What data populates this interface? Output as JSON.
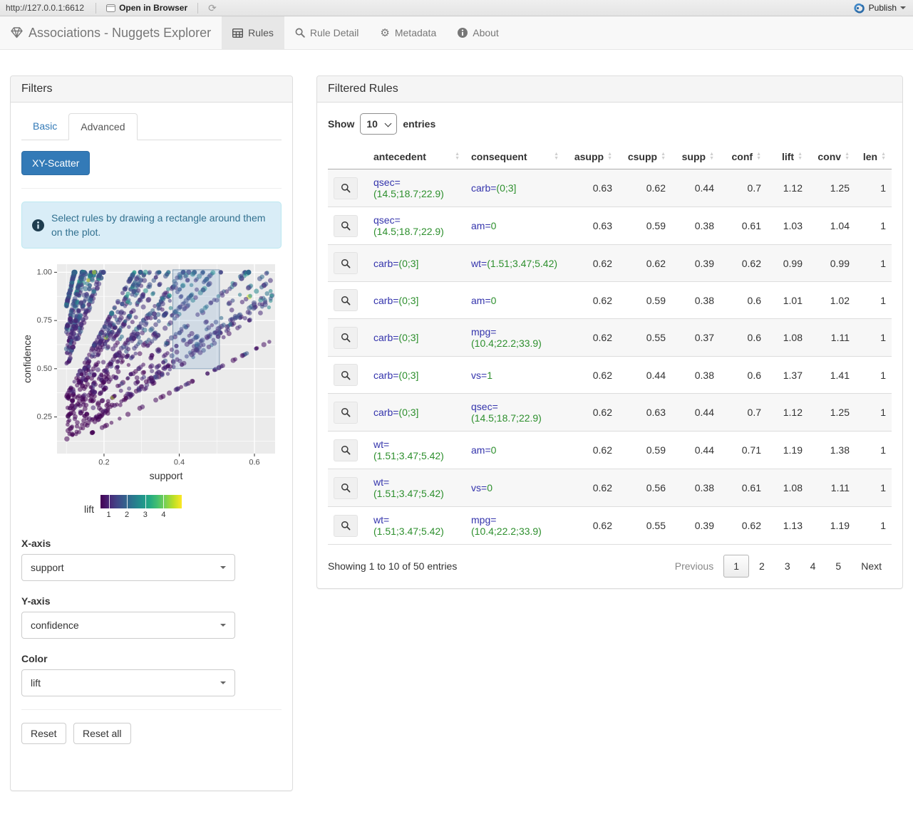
{
  "viewer_bar": {
    "url": "http://127.0.0.1:6612",
    "open_in_browser": "Open in Browser",
    "publish_label": "Publish"
  },
  "navbar": {
    "brand": "Associations - Nuggets Explorer",
    "tabs": [
      {
        "label": "Rules",
        "active": true
      },
      {
        "label": "Rule Detail",
        "active": false
      },
      {
        "label": "Metadata",
        "active": false
      },
      {
        "label": "About",
        "active": false
      }
    ]
  },
  "filters": {
    "title": "Filters",
    "tabs": {
      "basic": "Basic",
      "advanced": "Advanced",
      "active": "Advanced"
    },
    "scatter_button": "XY-Scatter",
    "info_text": "Select rules by drawing a rectangle around them on the plot.",
    "x_axis": {
      "label": "X-axis",
      "value": "support"
    },
    "y_axis": {
      "label": "Y-axis",
      "value": "confidence"
    },
    "color": {
      "label": "Color",
      "value": "lift"
    },
    "reset_label": "Reset",
    "reset_all_label": "Reset all"
  },
  "chart_data": {
    "type": "scatter",
    "xlabel": "support",
    "ylabel": "confidence",
    "xlim": [
      0.075,
      0.655
    ],
    "ylim": [
      0.06,
      1.042
    ],
    "x_ticks": [
      0.2,
      0.4,
      0.6
    ],
    "y_ticks": [
      0.25,
      0.5,
      0.75,
      1.0
    ],
    "panel_bg": "#ebebeb",
    "grid_color": "#ffffff",
    "selection_rect": {
      "x0": 0.383,
      "x1": 0.507,
      "y0": 0.5,
      "y1": 1.013,
      "fill": "rgba(114,159,207,0.22)",
      "stroke": "rgba(80,115,150,0.6)"
    },
    "color_scale": {
      "label": "lift",
      "ticks": [
        1,
        2,
        3,
        4
      ],
      "domain": [
        0.55,
        5.0
      ],
      "stops": [
        "#440154",
        "#482475",
        "#414487",
        "#355f8d",
        "#2a788e",
        "#21918c",
        "#22a884",
        "#44bf70",
        "#7ad151",
        "#bddf26",
        "#fde725"
      ]
    },
    "points_sim": {
      "seed": 42,
      "n_points": 1500,
      "min_support": 0.1,
      "max_support": 0.648,
      "min_confidence": 0.105,
      "point_alpha": 0.55,
      "note": "rule cloud: supp = asupp x conf with discrete antecedent supports (diagonal streaks through origin), dense band at supp 0.1-0.3, top row at conf = 1, sparse conf = supp diagonal at lower right"
    }
  },
  "rules_table": {
    "title": "Filtered Rules",
    "show_label": "Show",
    "entries_label": "entries",
    "page_length": "10",
    "columns": [
      "antecedent",
      "consequent",
      "asupp",
      "csupp",
      "supp",
      "conf",
      "lift",
      "conv",
      "len"
    ],
    "rows": [
      {
        "antecedent": {
          "attr": "qsec=",
          "value": "(14.5;18.7;22.9)"
        },
        "consequent": {
          "attr": "carb=",
          "value": "(0;3]"
        },
        "asupp": "0.63",
        "csupp": "0.62",
        "supp": "0.44",
        "conf": "0.7",
        "lift": "1.12",
        "conv": "1.25",
        "len": "1"
      },
      {
        "antecedent": {
          "attr": "qsec=",
          "value": "(14.5;18.7;22.9)"
        },
        "consequent": {
          "attr": "am=",
          "value": "0"
        },
        "asupp": "0.63",
        "csupp": "0.59",
        "supp": "0.38",
        "conf": "0.61",
        "lift": "1.03",
        "conv": "1.04",
        "len": "1"
      },
      {
        "antecedent": {
          "attr": "carb=",
          "value": "(0;3]"
        },
        "consequent": {
          "attr": "wt=",
          "value": "(1.51;3.47;5.42)"
        },
        "asupp": "0.62",
        "csupp": "0.62",
        "supp": "0.39",
        "conf": "0.62",
        "lift": "0.99",
        "conv": "0.99",
        "len": "1"
      },
      {
        "antecedent": {
          "attr": "carb=",
          "value": "(0;3]"
        },
        "consequent": {
          "attr": "am=",
          "value": "0"
        },
        "asupp": "0.62",
        "csupp": "0.59",
        "supp": "0.38",
        "conf": "0.6",
        "lift": "1.01",
        "conv": "1.02",
        "len": "1"
      },
      {
        "antecedent": {
          "attr": "carb=",
          "value": "(0;3]"
        },
        "consequent": {
          "attr": "mpg=",
          "value": "(10.4;22.2;33.9)"
        },
        "asupp": "0.62",
        "csupp": "0.55",
        "supp": "0.37",
        "conf": "0.6",
        "lift": "1.08",
        "conv": "1.11",
        "len": "1"
      },
      {
        "antecedent": {
          "attr": "carb=",
          "value": "(0;3]"
        },
        "consequent": {
          "attr": "vs=",
          "value": "1"
        },
        "asupp": "0.62",
        "csupp": "0.44",
        "supp": "0.38",
        "conf": "0.6",
        "lift": "1.37",
        "conv": "1.41",
        "len": "1"
      },
      {
        "antecedent": {
          "attr": "carb=",
          "value": "(0;3]"
        },
        "consequent": {
          "attr": "qsec=",
          "value": "(14.5;18.7;22.9)"
        },
        "asupp": "0.62",
        "csupp": "0.63",
        "supp": "0.44",
        "conf": "0.7",
        "lift": "1.12",
        "conv": "1.25",
        "len": "1"
      },
      {
        "antecedent": {
          "attr": "wt=",
          "value": "(1.51;3.47;5.42)"
        },
        "consequent": {
          "attr": "am=",
          "value": "0"
        },
        "asupp": "0.62",
        "csupp": "0.59",
        "supp": "0.44",
        "conf": "0.71",
        "lift": "1.19",
        "conv": "1.38",
        "len": "1"
      },
      {
        "antecedent": {
          "attr": "wt=",
          "value": "(1.51;3.47;5.42)"
        },
        "consequent": {
          "attr": "vs=",
          "value": "0"
        },
        "asupp": "0.62",
        "csupp": "0.56",
        "supp": "0.38",
        "conf": "0.61",
        "lift": "1.08",
        "conv": "1.11",
        "len": "1"
      },
      {
        "antecedent": {
          "attr": "wt=",
          "value": "(1.51;3.47;5.42)"
        },
        "consequent": {
          "attr": "mpg=",
          "value": "(10.4;22.2;33.9)"
        },
        "asupp": "0.62",
        "csupp": "0.55",
        "supp": "0.39",
        "conf": "0.62",
        "lift": "1.13",
        "conv": "1.19",
        "len": "1"
      }
    ],
    "info": "Showing 1 to 10 of 50 entries",
    "pagination": {
      "previous": "Previous",
      "pages": [
        "1",
        "2",
        "3",
        "4",
        "5"
      ],
      "active_page": "1",
      "next": "Next"
    }
  }
}
